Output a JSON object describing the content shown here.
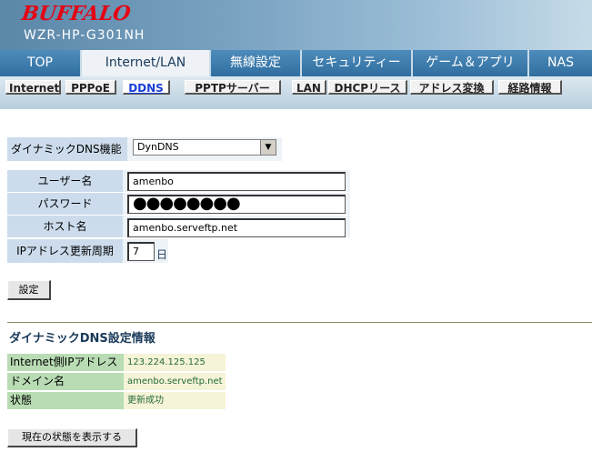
{
  "header": {
    "brand": "BUFFALO",
    "model": "WZR-HP-G301NH"
  },
  "main_tabs": [
    "TOP",
    "Internet/LAN",
    "無線設定",
    "セキュリティー",
    "ゲーム＆アプリ",
    "NAS"
  ],
  "main_tabs_active": "Internet/LAN",
  "sub_tabs": [
    "Internet",
    "PPPoE",
    "DDNS",
    "PPTPサーバー",
    "LAN",
    "DHCPリース",
    "アドレス変換",
    "経路情報"
  ],
  "sub_tabs_active": "DDNS",
  "form": {
    "ddns_label": "ダイナミックDNS機能",
    "ddns_value": "DynDNS",
    "username_label": "ユーザー名",
    "username_value": "amenbo",
    "password_label": "パスワード",
    "password_value": "●●●●●●●●",
    "hostname_label": "ホスト名",
    "hostname_value": "amenbo.serveftp.net",
    "interval_label": "IPアドレス更新周期",
    "interval_value": "7",
    "interval_unit": "日",
    "submit_label": "設定"
  },
  "info": {
    "title": "ダイナミックDNS設定情報",
    "ip_label": "Internet側IPアドレス",
    "ip_value": "123.224.125.125",
    "domain_label": "ドメイン名",
    "domain_value": "amenbo.serveftp.net",
    "status_label": "状態",
    "status_value": "更新成功",
    "refresh_label": "現在の状態を表示する"
  }
}
